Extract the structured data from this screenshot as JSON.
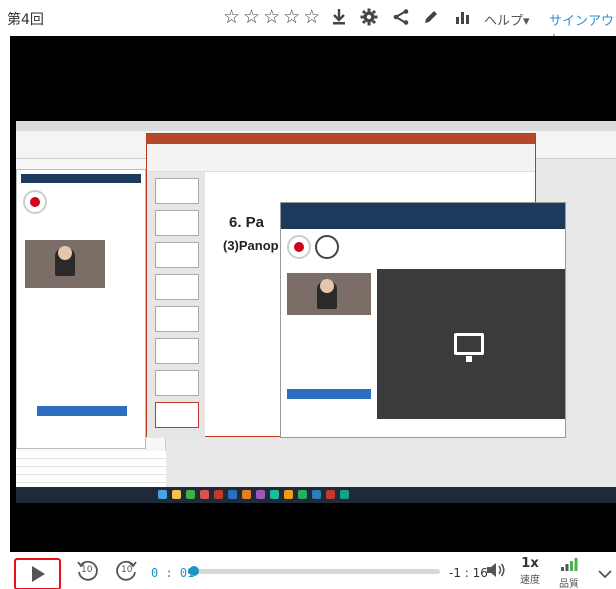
{
  "header": {
    "title": "第4回",
    "rating": {
      "stars_total": 5,
      "stars_filled": 0,
      "star_glyph": "☆"
    },
    "icons": [
      "download-icon",
      "gear-icon",
      "share-icon",
      "pencil-icon",
      "stats-icon"
    ],
    "help_label": "ヘルプ▾",
    "signin_label": "サインアウト"
  },
  "video": {
    "slide_heading": "6. Pa",
    "slide_subheading": "(3)Panop"
  },
  "controls": {
    "current_time": "0 : 01",
    "remaining_time": "-1 : 16",
    "progress": 0.013,
    "rewind_label": "10",
    "forward_label": "10",
    "speed_value": "1x",
    "speed_label": "速度",
    "quality_label": "品質",
    "accent_color": "#1c94c4",
    "highlight_color": "#e6101a"
  }
}
